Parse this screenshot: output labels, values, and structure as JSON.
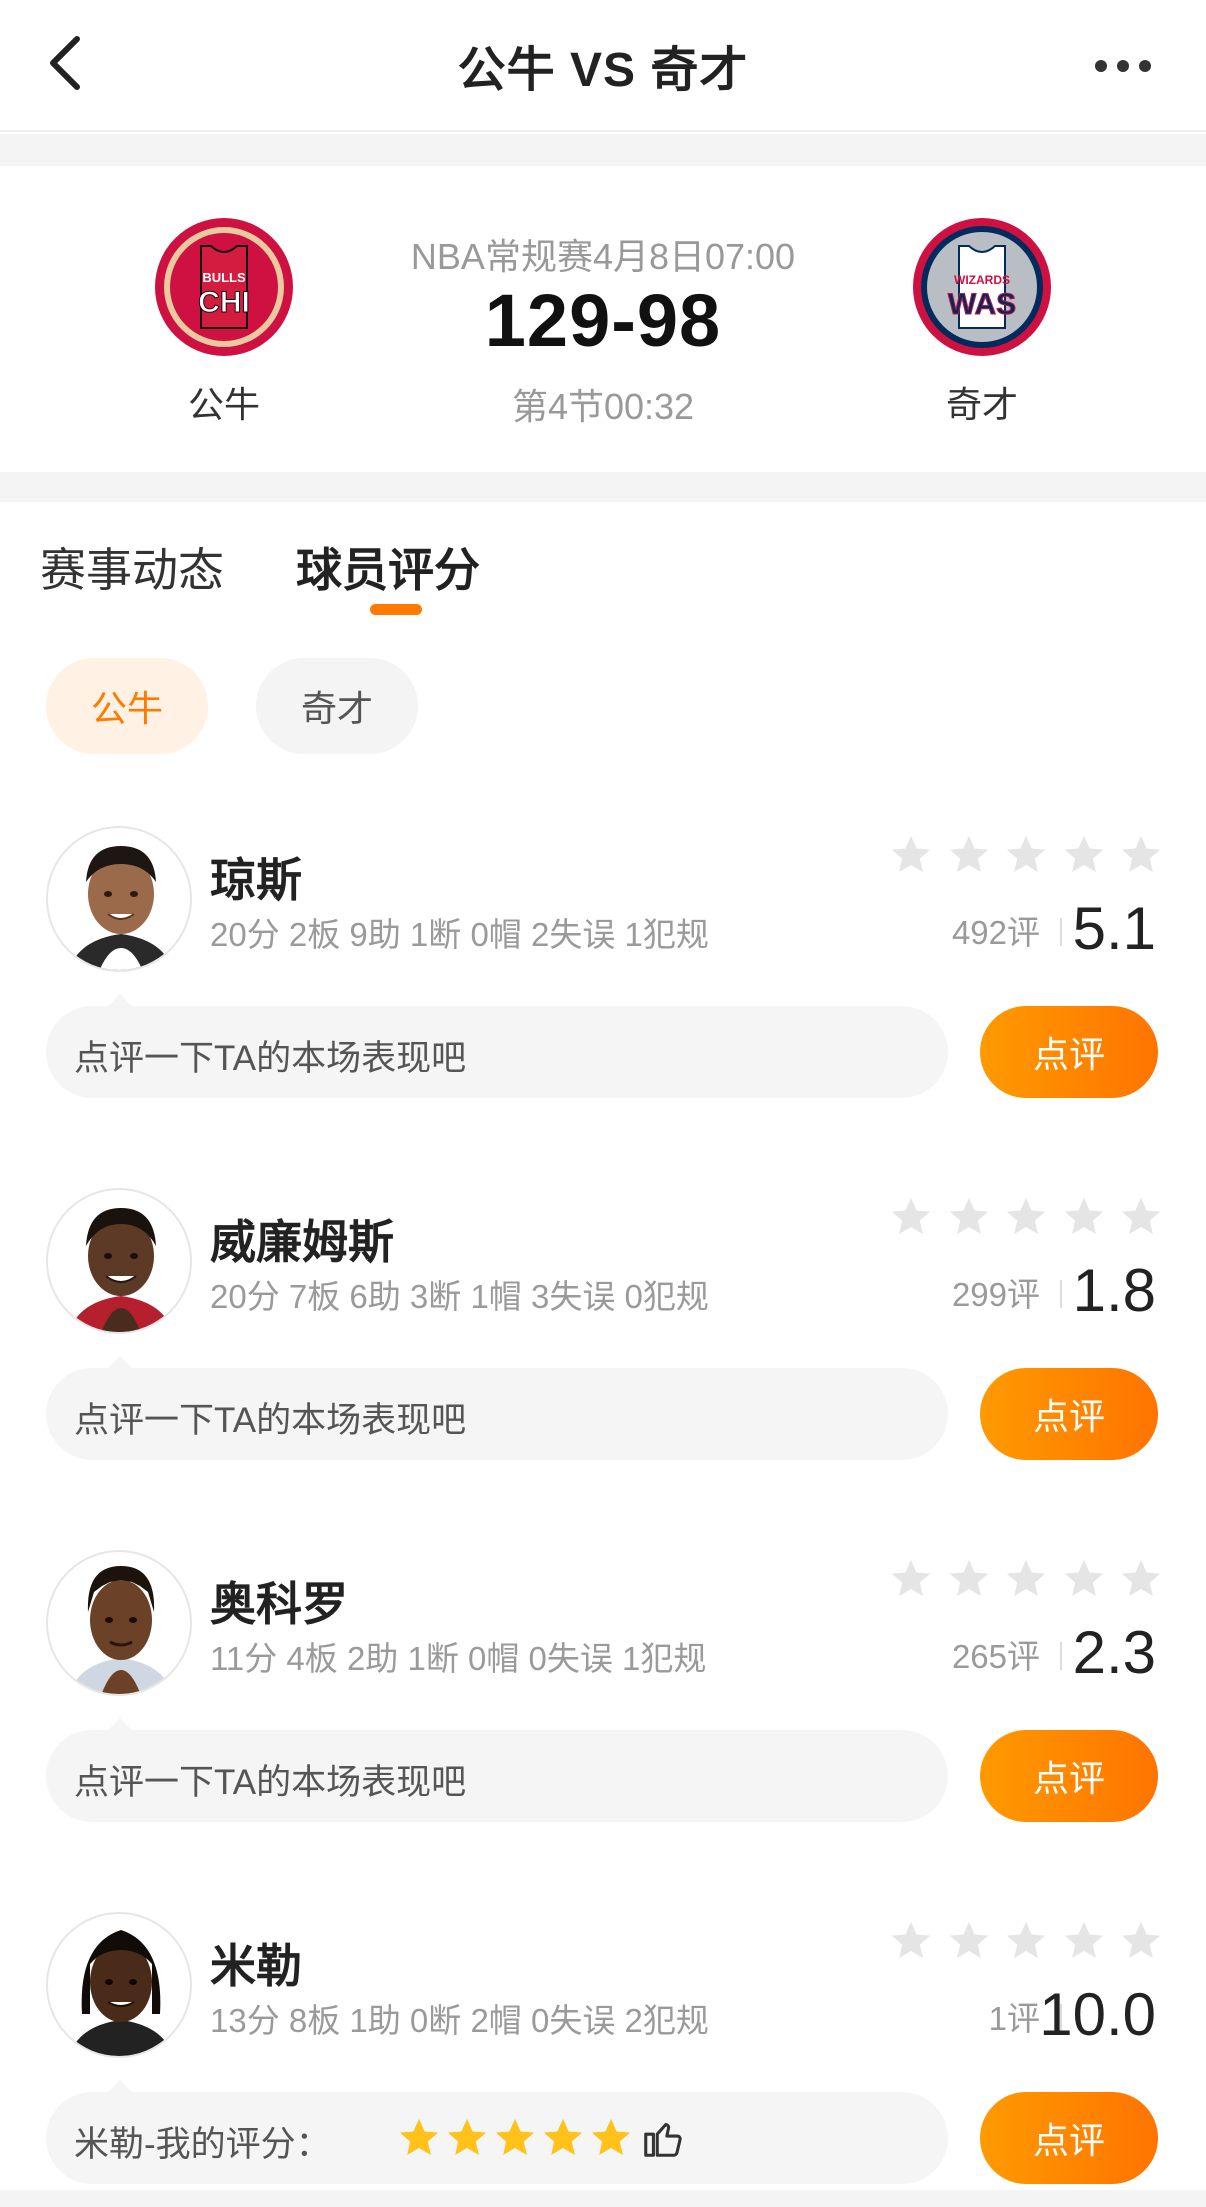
{
  "nav": {
    "title": "公牛 VS 奇才",
    "back_icon": "chevron-left-icon",
    "more_icon": "more-dots-icon"
  },
  "match": {
    "meta": "NBA常规赛4月8日07:00",
    "score": "129-98",
    "status": "第4节00:32",
    "home": {
      "name": "公牛",
      "logo_text_top": "BULLS",
      "logo_text": "CHI",
      "color": "#ce1141"
    },
    "away": {
      "name": "奇才",
      "logo_text_top": "WIZARDS",
      "logo_text": "WAS",
      "color": "#002b5c"
    }
  },
  "tabs": [
    {
      "label": "赛事动态",
      "active": false
    },
    {
      "label": "球员评分",
      "active": true
    }
  ],
  "team_filter": [
    {
      "label": "公牛",
      "active": true
    },
    {
      "label": "奇才",
      "active": false
    }
  ],
  "colors": {
    "accent": "#ff7a00",
    "star_empty": "#e5e5e5",
    "star_filled": "#ffc21a"
  },
  "players": [
    {
      "name": "琼斯",
      "stats": "20分 2板 9助 1断 0帽 2失误 1犯规",
      "count": "492评",
      "rating": "5.1",
      "comment_placeholder": "点评一下TA的本场表现吧",
      "button": "点评"
    },
    {
      "name": "威廉姆斯",
      "stats": "20分 7板 6助 3断 1帽 3失误 0犯规",
      "count": "299评",
      "rating": "1.8",
      "comment_placeholder": "点评一下TA的本场表现吧",
      "button": "点评"
    },
    {
      "name": "奥科罗",
      "stats": "11分 4板 2助 1断 0帽 0失误 1犯规",
      "count": "265评",
      "rating": "2.3",
      "comment_placeholder": "点评一下TA的本场表现吧",
      "button": "点评"
    },
    {
      "name": "米勒",
      "stats": "13分 8板 1助 0断 2帽 0失误 2犯规",
      "count": "1评",
      "rating": "10.0",
      "my_rating_label": "米勒-我的评分：",
      "my_rating_stars": 5,
      "button": "点评"
    }
  ]
}
